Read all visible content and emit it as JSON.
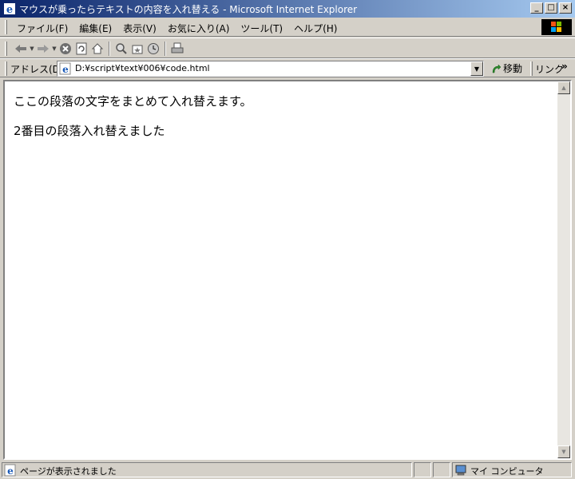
{
  "window": {
    "title": "マウスが乗ったらテキストの内容を入れ替える - Microsoft Internet Explorer",
    "minimize_glyph": "_",
    "maximize_glyph": "□",
    "close_glyph": "×"
  },
  "menu": {
    "items": [
      {
        "label": "ファイル(F)"
      },
      {
        "label": "編集(E)"
      },
      {
        "label": "表示(V)"
      },
      {
        "label": "お気に入り(A)"
      },
      {
        "label": "ツール(T)"
      },
      {
        "label": "ヘルプ(H)"
      }
    ]
  },
  "toolbar": {
    "icons": [
      "back-icon",
      "forward-icon",
      "stop-icon",
      "refresh-icon",
      "home-icon",
      "search-icon",
      "favorites-icon",
      "history-icon",
      "print-icon"
    ]
  },
  "address": {
    "label": "アドレス(D)",
    "value": "D:¥script¥text¥006¥code.html",
    "go_label": "移動",
    "links_label": "リンク",
    "more_glyph": "»"
  },
  "page": {
    "paragraphs": [
      "ここの段落の文字をまとめて入れ替えます。",
      "2番目の段落入れ替えました"
    ]
  },
  "status": {
    "text": "ページが表示されました",
    "zone": "マイ コンピュータ"
  },
  "colors": {
    "titlebar_start": "#0a246a",
    "titlebar_end": "#a6caf0",
    "chrome": "#d4d0c8"
  }
}
